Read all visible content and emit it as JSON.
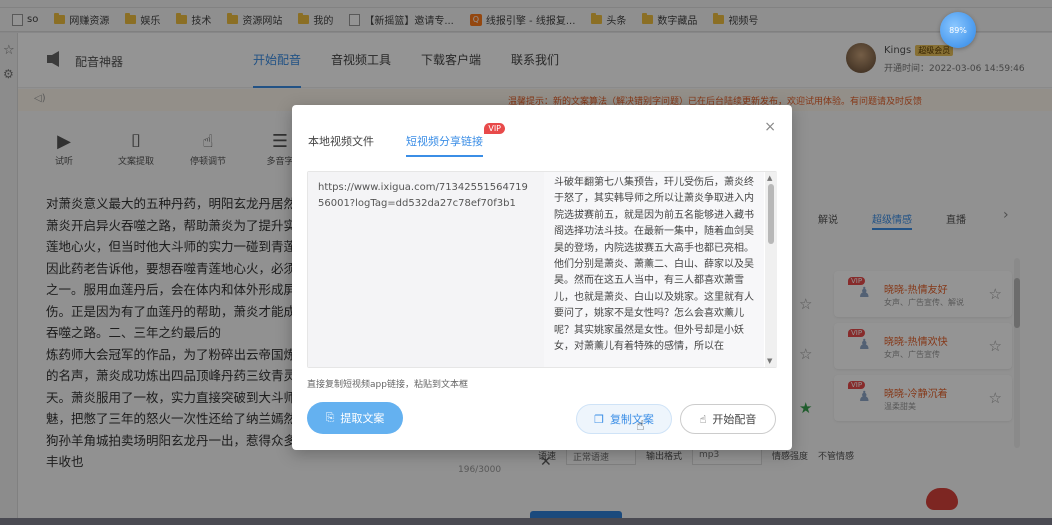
{
  "bookmarks": [
    {
      "label": "so",
      "icon": "page"
    },
    {
      "label": "网赚资源",
      "icon": "folder"
    },
    {
      "label": "娱乐",
      "icon": "folder"
    },
    {
      "label": "技术",
      "icon": "folder"
    },
    {
      "label": "资源网站",
      "icon": "folder"
    },
    {
      "label": "我的",
      "icon": "folder"
    },
    {
      "label": "【新摇篮】邀请专...",
      "icon": "page"
    },
    {
      "label": "线报引擎 - 线报复...",
      "icon": "logo"
    },
    {
      "label": "头条",
      "icon": "folder"
    },
    {
      "label": "数字藏品",
      "icon": "folder"
    },
    {
      "label": "视频号",
      "icon": "folder"
    }
  ],
  "bookmark_logo_glyph": "Q",
  "profile_bubble": "89%",
  "app": {
    "title": "配音神器",
    "nav": [
      "开始配音",
      "音视频工具",
      "下载客户端",
      "联系我们"
    ],
    "user": {
      "name": "Kings",
      "tag": "超级会员",
      "expire": "开通时间：2022-03-06 14:59:46"
    },
    "notice": "温馨提示：新的文案算法（解决错别字问题）已在后台陆续更新发布，欢迎试用体验。有问题请及时反馈"
  },
  "toolbar": [
    "试听",
    "文案提取",
    "停顿调节",
    "多音字"
  ],
  "editor_lines": [
    "对萧炎意义最大的五种丹药，明阳玄龙丹居然",
    "萧炎开启异火吞噬之路，帮助萧炎为了提升实力",
    "莲地心火，但当时他大斗师的实力一碰到青莲",
    "因此药老告诉他，要想吞噬青莲地心火，必须",
    "之一。服用血莲丹后，会在体内和体外形成屏障",
    "伤。正是因为有了血莲丹的帮助，萧炎才能成功",
    "吞噬之路。二、三年之约最后的",
    "炼药师大会冠军的作品，为了粉碎出云帝国炼",
    "的名声，萧炎成功炼出四品顶峰丹药三纹青灵",
    "天。萧炎服用了一枚，实力直接突破到大斗师",
    "魅，把憋了三年的怒火一次性还给了纳兰嫣然",
    "狗孙羊角城拍卖场明阳玄龙丹一出，惹得众多",
    "丰收也"
  ],
  "right_panel": {
    "tabs": [
      "解说",
      "超级情感",
      "直播"
    ],
    "voices": [
      {
        "vip": "VIP",
        "name": "晓晓-热情友好",
        "sub": "女声、广告宣传、解说"
      },
      {
        "vip": "VIP",
        "name": "晓晓-热情欢快",
        "sub": "女声、广告宣传"
      },
      {
        "vip": "VIP",
        "name": "晓晓-冷静沉着",
        "sub": "温柔甜美"
      }
    ]
  },
  "bottom_bar": {
    "labels": [
      "语速",
      "正常语速",
      "输出格式",
      "mp3",
      "情感强度",
      "不管情感"
    ],
    "count": "196/3000"
  },
  "modal": {
    "tabs": [
      "本地视频文件",
      "短视频分享链接"
    ],
    "vip_badge": "VIP",
    "url": "https://www.ixigua.com/7134255156471956001?logTag=dd532da27c78ef70f3b1",
    "transcript": "斗破年翻第七八集预告，玕儿受伤后，萧炎终于怒了，其实韩导师之所以让萧炎争取进入内院选拔赛前五，就是因为前五名能够进入藏书阁选择功法斗技。在最新一集中，随着血剑吴昊的登场，内院选拔赛五大高手也都已亮相。他们分别是萧炎、萧薰二、白山、薛家以及吴昊。然而在这五人当中，有三人都喜欢萧雪儿，也就是萧炎、白山以及姚家。这里就有人要问了，姚家不是女性吗？怎么会喜欢薰儿呢？其实姚家虽然是女性。但外号却是小妖女，对萧薰儿有着特殊的感情，所以在",
    "hint": "直接复制短视频app链接，粘贴到文本框",
    "buttons": {
      "extract": "提取文案",
      "copy": "复制文案",
      "start": "开始配音"
    },
    "close_glyph": "×"
  }
}
